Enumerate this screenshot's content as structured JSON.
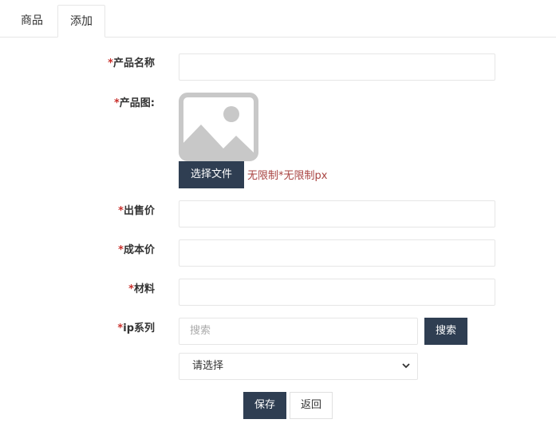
{
  "tabs": [
    {
      "label": "商品"
    },
    {
      "label": "添加"
    }
  ],
  "form": {
    "required_mark": "*",
    "fields": {
      "product_name": {
        "label": "产品名称",
        "value": ""
      },
      "product_image": {
        "label": "产品图:",
        "choose_file": "选择文件",
        "hint": "无限制*无限制px"
      },
      "sale_price": {
        "label": "出售价",
        "value": ""
      },
      "cost_price": {
        "label": "成本价",
        "value": ""
      },
      "material": {
        "label": "材料",
        "value": ""
      },
      "ip_series": {
        "label": "ip系列",
        "search_placeholder": "搜索",
        "search_button": "搜索",
        "select_value": "请选择"
      }
    },
    "actions": {
      "save": "保存",
      "back": "返回"
    }
  },
  "colors": {
    "primary_button": "#2f3e52",
    "required": "#c9302c",
    "hint": "#a94442"
  }
}
